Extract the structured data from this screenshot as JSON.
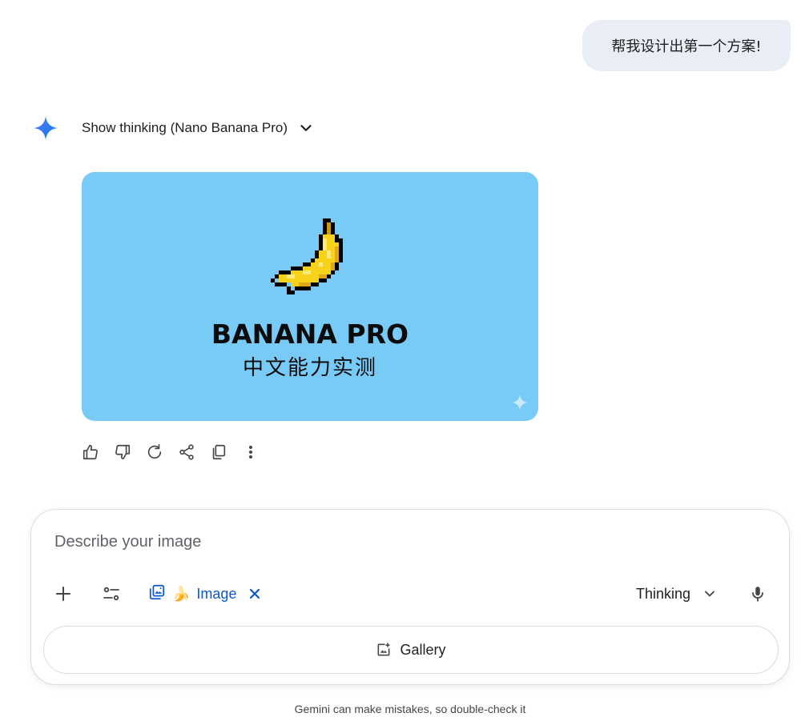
{
  "user_message": {
    "text": "帮我设计出第一个方案!"
  },
  "response": {
    "thinking_label": "Show thinking (Nano Banana Pro)",
    "image": {
      "title": "BANANA PRO",
      "subtitle": "中文能力实测",
      "background_color": "#79cbf7"
    },
    "actions": [
      {
        "name": "thumbs-up",
        "icon": "thumbs-up-icon"
      },
      {
        "name": "thumbs-down",
        "icon": "thumbs-down-icon"
      },
      {
        "name": "regenerate",
        "icon": "refresh-icon"
      },
      {
        "name": "share",
        "icon": "share-icon"
      },
      {
        "name": "copy",
        "icon": "copy-icon"
      },
      {
        "name": "more",
        "icon": "more-vertical-icon"
      }
    ]
  },
  "composer": {
    "placeholder": "Describe your image",
    "tool_chip": {
      "emoji": "🍌",
      "label": "Image"
    },
    "mode": "Thinking",
    "gallery_label": "Gallery"
  },
  "footer": {
    "disclaimer": "Gemini can make mistakes, so double-check it"
  },
  "colors": {
    "accent": "#0b57d0",
    "bubble": "#e9eef6",
    "text": "#1f1f1f"
  }
}
